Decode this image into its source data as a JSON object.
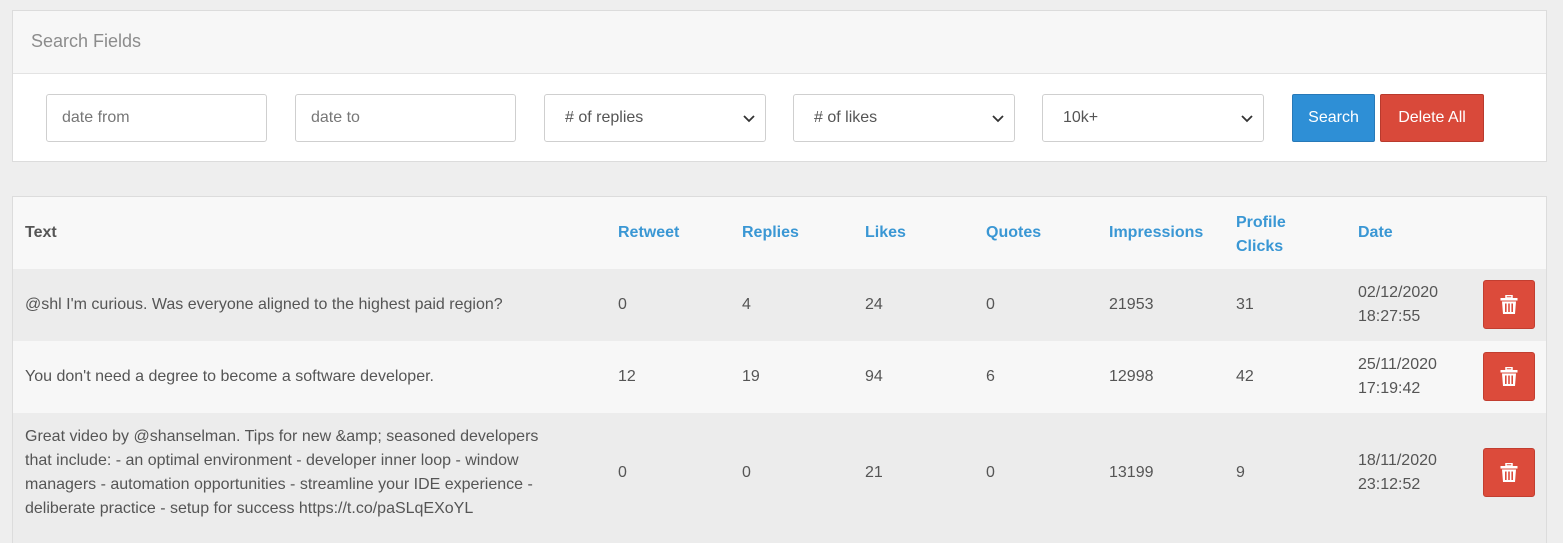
{
  "search_panel": {
    "title": "Search Fields",
    "date_from_placeholder": "date from",
    "date_to_placeholder": "date to",
    "replies_select": "# of replies",
    "likes_select": "# of likes",
    "count_select": "10k+",
    "search_label": "Search",
    "delete_all_label": "Delete All"
  },
  "table": {
    "columns": {
      "text": "Text",
      "retweet": "Retweet",
      "replies": "Replies",
      "likes": "Likes",
      "quotes": "Quotes",
      "impressions": "Impressions",
      "profile_clicks_1": "Profile",
      "profile_clicks_2": "Clicks",
      "date": "Date"
    },
    "rows": [
      {
        "text": "@shl I'm curious. Was everyone aligned to the highest paid region?",
        "retweet": "0",
        "replies": "4",
        "likes": "24",
        "quotes": "0",
        "impressions": "21953",
        "profile_clicks": "31",
        "date": "02/12/2020",
        "time": "18:27:55"
      },
      {
        "text": "You don't need a degree to become a software developer.",
        "retweet": "12",
        "replies": "19",
        "likes": "94",
        "quotes": "6",
        "impressions": "12998",
        "profile_clicks": "42",
        "date": "25/11/2020",
        "time": "17:19:42"
      },
      {
        "text_lines": [
          "Great video by @shanselman. Tips for new &amp; seasoned developers",
          "that include: - an optimal environment - developer inner loop - window",
          "managers - automation opportunities - streamline your IDE experience -",
          "deliberate practice - setup for success https://t.co/paSLqEXoYL"
        ],
        "retweet": "0",
        "replies": "0",
        "likes": "21",
        "quotes": "0",
        "impressions": "13199",
        "profile_clicks": "9",
        "date": "18/11/2020",
        "time": "23:12:52"
      }
    ]
  },
  "colors": {
    "link_blue": "#3a97d4",
    "search_button": "#2e8fd6",
    "delete_red": "#d9493a"
  }
}
